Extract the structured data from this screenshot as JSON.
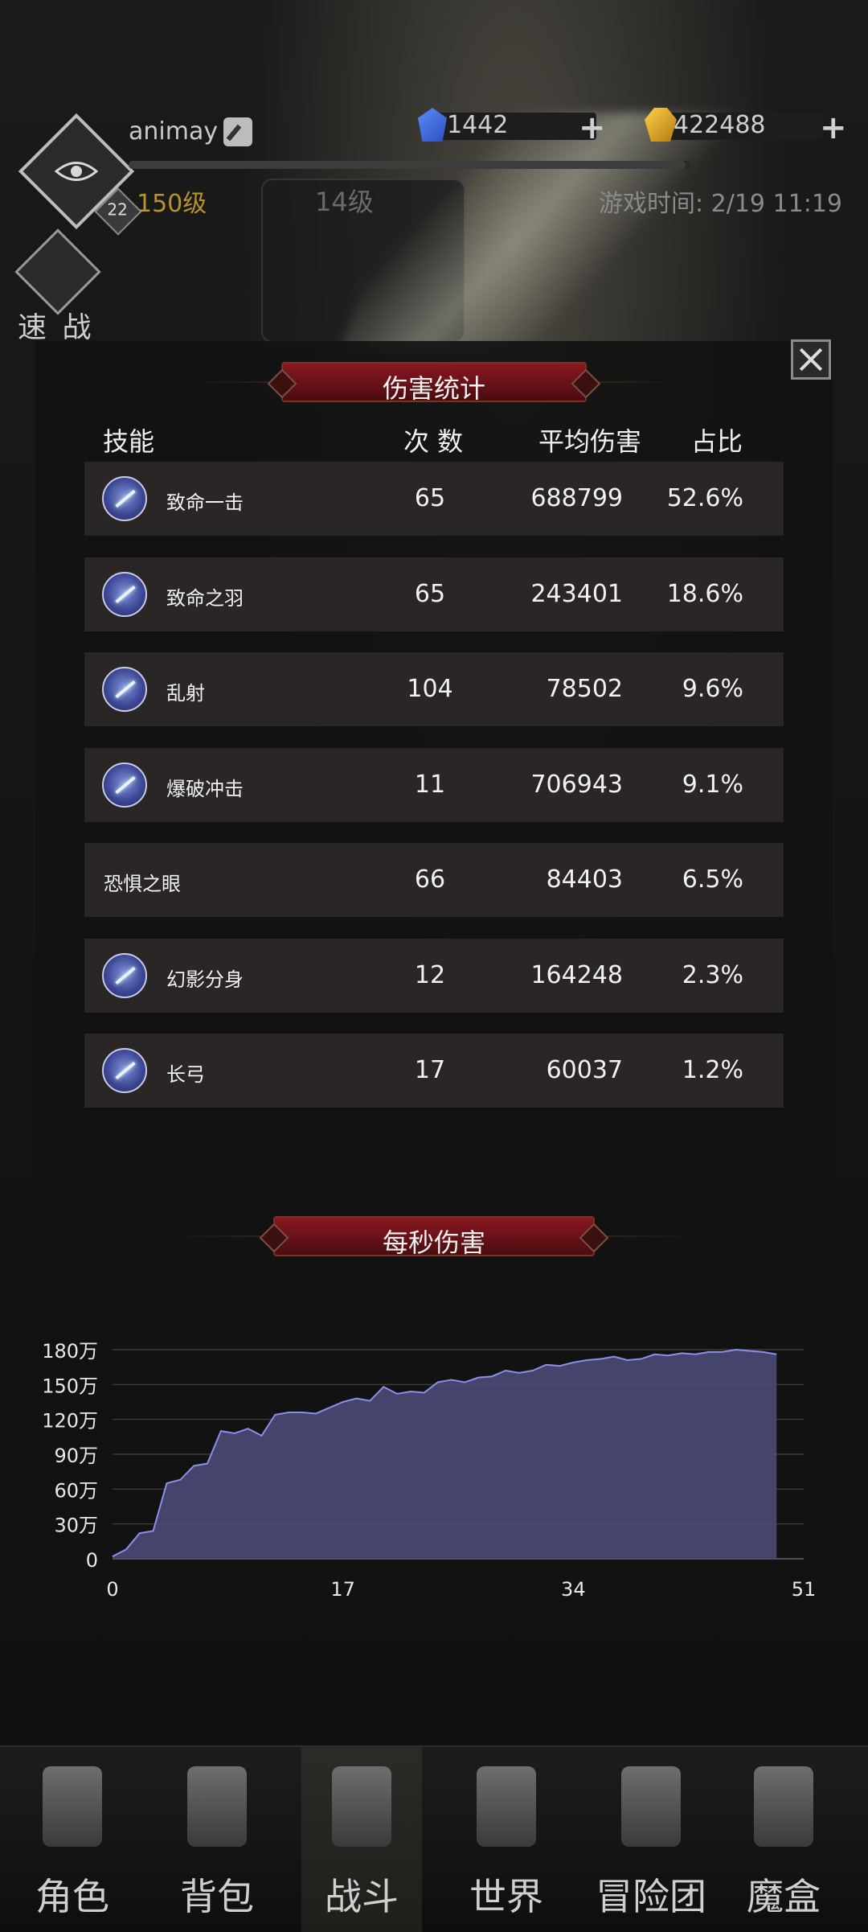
{
  "header": {
    "username": "animay",
    "player_level": "150级",
    "bg_level": "14级",
    "avatar_badge": "22",
    "game_time_label": "游戏时间: 2/19 11:19",
    "quick_battle_label": "速 战",
    "exp_fraction": 0.99
  },
  "currency": {
    "gems": "1442",
    "gold": "422488"
  },
  "damage_stats": {
    "title": "伤害统计",
    "columns": {
      "skill": "技能",
      "count": "次 数",
      "avg": "平均伤害",
      "ratio": "占比"
    },
    "rows": [
      {
        "name": "致命一击",
        "count": "65",
        "avg": "688799",
        "pct": "52.6%",
        "has_icon": true,
        "icon": "critical-strike-icon"
      },
      {
        "name": "致命之羽",
        "count": "65",
        "avg": "243401",
        "pct": "18.6%",
        "has_icon": true,
        "icon": "deadly-feather-icon"
      },
      {
        "name": "乱射",
        "count": "104",
        "avg": "78502",
        "pct": "9.6%",
        "has_icon": true,
        "icon": "barrage-icon"
      },
      {
        "name": "爆破冲击",
        "count": "11",
        "avg": "706943",
        "pct": "9.1%",
        "has_icon": true,
        "icon": "blast-impact-icon"
      },
      {
        "name": "恐惧之眼",
        "count": "66",
        "avg": "84403",
        "pct": "6.5%",
        "has_icon": false,
        "icon": ""
      },
      {
        "name": "幻影分身",
        "count": "12",
        "avg": "164248",
        "pct": "2.3%",
        "has_icon": true,
        "icon": "phantom-clone-icon"
      },
      {
        "name": "长弓",
        "count": "17",
        "avg": "60037",
        "pct": "1.2%",
        "has_icon": true,
        "icon": "longbow-icon"
      }
    ]
  },
  "dps": {
    "title": "每秒伤害"
  },
  "chart_data": {
    "type": "area",
    "title": "每秒伤害",
    "xlabel": "",
    "ylabel": "",
    "xlim": [
      0,
      51
    ],
    "ylim": [
      0,
      180
    ],
    "x_ticks": [
      0,
      17,
      34,
      51
    ],
    "x_tick_labels": [
      "0",
      "17",
      "34",
      "51"
    ],
    "y_ticks": [
      0,
      30,
      60,
      90,
      120,
      150,
      180
    ],
    "y_tick_labels": [
      "0",
      "30万",
      "60万",
      "90万",
      "120万",
      "150万",
      "180万"
    ],
    "grid": true,
    "fill_color": "#4a4a78",
    "line_color": "#8890e8",
    "series": [
      {
        "x": [
          0,
          1,
          2,
          3,
          4,
          5,
          6,
          7,
          8,
          9,
          10,
          11,
          12,
          13,
          14,
          15,
          16,
          17,
          18,
          19,
          20,
          21,
          22,
          23,
          24,
          25,
          26,
          27,
          28,
          29,
          30,
          31,
          32,
          33,
          34,
          35,
          36,
          37,
          38,
          39,
          40,
          41,
          42,
          43,
          44,
          45,
          46,
          47,
          48,
          49
        ],
        "values": [
          2,
          8,
          22,
          24,
          65,
          68,
          80,
          82,
          110,
          108,
          112,
          106,
          124,
          126,
          126,
          125,
          130,
          135,
          138,
          136,
          148,
          142,
          144,
          143,
          152,
          154,
          152,
          156,
          157,
          162,
          160,
          162,
          167,
          166,
          169,
          171,
          172,
          174,
          171,
          172,
          176,
          175,
          177,
          176,
          178,
          178,
          180,
          179,
          178,
          176
        ]
      }
    ]
  },
  "nav": {
    "items": [
      {
        "label": "角色",
        "icon": "helmet-icon"
      },
      {
        "label": "背包",
        "icon": "backpack-icon"
      },
      {
        "label": "战斗",
        "icon": "sword-shield-icon"
      },
      {
        "label": "世界",
        "icon": "map-scroll-icon"
      },
      {
        "label": "冒险团",
        "icon": "castle-icon"
      },
      {
        "label": "魔盒",
        "icon": "magic-box-icon"
      }
    ],
    "active_index": 2
  }
}
